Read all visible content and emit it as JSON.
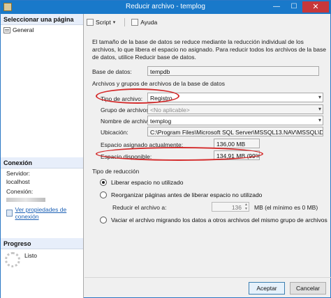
{
  "window": {
    "title": "Reducir archivo - templog",
    "close_glyph": "✕",
    "min_glyph": "—",
    "max_glyph": "☐"
  },
  "left": {
    "header": "Seleccionar una página",
    "items": [
      {
        "label": "General"
      }
    ],
    "connection": {
      "header": "Conexión",
      "server_label": "Servidor:",
      "server_value": "localhost",
      "conn_label": "Conexión:",
      "link": "Ver propiedades de conexión"
    },
    "progress": {
      "header": "Progreso",
      "status": "Listo"
    }
  },
  "toolbar": {
    "script": "Script",
    "help": "Ayuda"
  },
  "main": {
    "description": "El tamaño de la base de datos se reduce mediante la reducción individual de los archivos, lo que libera el espacio no asignado. Para reducir todos los archivos de la base de datos, utilice Reducir base de datos.",
    "db_label": "Base de datos:",
    "db_value": "tempdb",
    "group_title": "Archivos y grupos de archivos de la base de datos",
    "file_type_label": "Tipo de archivo:",
    "file_type_value": "Registro",
    "filegroup_label": "Grupo de archivos:",
    "filegroup_value": "<No aplicable>",
    "filename_label": "Nombre de archivo:",
    "filename_value": "templog",
    "location_label": "Ubicación:",
    "location_value": "C:\\Program Files\\Microsoft SQL Server\\MSSQL13.NAV\\MSSQL\\DATA\\tem",
    "allocated_label": "Espacio asignado actualmente:",
    "allocated_value": "136,00 MB",
    "available_label": "Espacio disponible:",
    "available_value": "134,91 MB (99%)",
    "shrink_type_title": "Tipo de reducción",
    "options": [
      {
        "label": "Liberar espacio no utilizado",
        "selected": true
      },
      {
        "label": "Reorganizar páginas antes de liberar espacio no utilizado",
        "selected": false
      },
      {
        "label": "Vaciar el archivo migrando los datos a otros archivos del mismo grupo de archivos",
        "selected": false
      }
    ],
    "reduce_label": "Reducir el archivo a:",
    "reduce_value": "136",
    "reduce_hint": "MB (el mínimo es 0 MB)"
  },
  "buttons": {
    "ok": "Aceptar",
    "cancel": "Cancelar"
  },
  "colors": {
    "title_bar": "#1979ca",
    "annotation": "#d42a2a"
  }
}
